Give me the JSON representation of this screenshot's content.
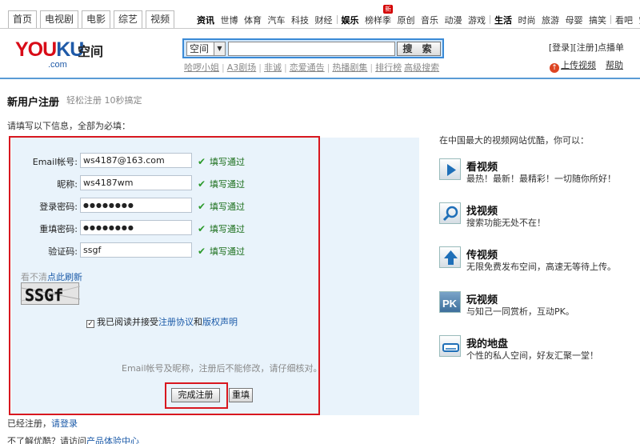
{
  "nav": {
    "tabs": [
      "首页",
      "电视剧",
      "电影",
      "综艺",
      "视频"
    ],
    "groups": [
      {
        "lead": "资讯",
        "items": [
          "世博",
          "体育",
          "汽车",
          "科技",
          "财经"
        ]
      },
      {
        "lead": "娱乐",
        "items": [
          "榜样季",
          "原创",
          "音乐",
          "动漫",
          "游戏"
        ]
      },
      {
        "lead": "生活",
        "items": [
          "时尚",
          "旅游",
          "母婴",
          "搞笑"
        ]
      },
      {
        "lead": "",
        "items": [
          "看吧",
          "空间"
        ]
      }
    ],
    "new_badge": "新"
  },
  "header": {
    "logo_text": "YOUKU",
    "logo_sub": ".com",
    "section_title": "空间",
    "search_scope": "空间",
    "search_placeholder": "",
    "search_button": "搜 索",
    "hot_links": [
      "哈啰小姐",
      "A3剧场",
      "非诚",
      "恋爱通告",
      "热播剧集",
      "排行榜",
      "高级搜索"
    ],
    "account_links": [
      "[登录]",
      "[注册]",
      "点播单"
    ],
    "upload": "上传视频",
    "help": "帮助"
  },
  "page": {
    "title": "新用户注册",
    "subtitle": "轻松注册  10秒搞定",
    "hint": "请填写以下信息，全部为必填："
  },
  "form": {
    "fields": [
      {
        "label": "Email帐号:",
        "value": "ws4187@163.com",
        "status": "填写通过"
      },
      {
        "label": "昵称:",
        "value": "ws4187wm",
        "status": "填写通过"
      },
      {
        "label": "登录密码:",
        "value": "●●●●●●●●",
        "status": "填写通过"
      },
      {
        "label": "重填密码:",
        "value": "●●●●●●●●",
        "status": "填写通过"
      },
      {
        "label": "验证码:",
        "value": "ssgf",
        "status": "填写通过"
      }
    ],
    "refresh_prefix": "看不清",
    "refresh_link": "点此刷新",
    "captcha_text": "SSGf",
    "agree_prefix": "我已阅读并接受",
    "agree_link1": "注册协议",
    "agree_and": "和",
    "agree_link2": "版权声明",
    "note": "Email帐号及昵称，注册后不能修改，请仔细核对。",
    "submit": "完成注册",
    "reset": "重填"
  },
  "footer": {
    "already_prefix": "已经注册，",
    "already_link": "请登录",
    "unknown_prefix": "不了解优酷？请访问",
    "unknown_link": "产品体验中心"
  },
  "right": {
    "title": "在中国最大的视频网站优酷，你可以：",
    "features": [
      {
        "name": "看视频",
        "desc": "最热！最新！最精彩！一切随你所好！",
        "icon": "play-icon"
      },
      {
        "name": "找视频",
        "desc": "搜索功能无处不在！",
        "icon": "search-icon"
      },
      {
        "name": "传视频",
        "desc": "无限免费发布空间，高速无等待上传。",
        "icon": "upload-icon"
      },
      {
        "name": "玩视频",
        "desc": "与知己一同赏析，互动PK。",
        "icon": "pk-icon"
      },
      {
        "name": "我的地盘",
        "desc": "个性的私人空间，好友汇聚一堂！",
        "icon": "disk-icon"
      }
    ]
  }
}
